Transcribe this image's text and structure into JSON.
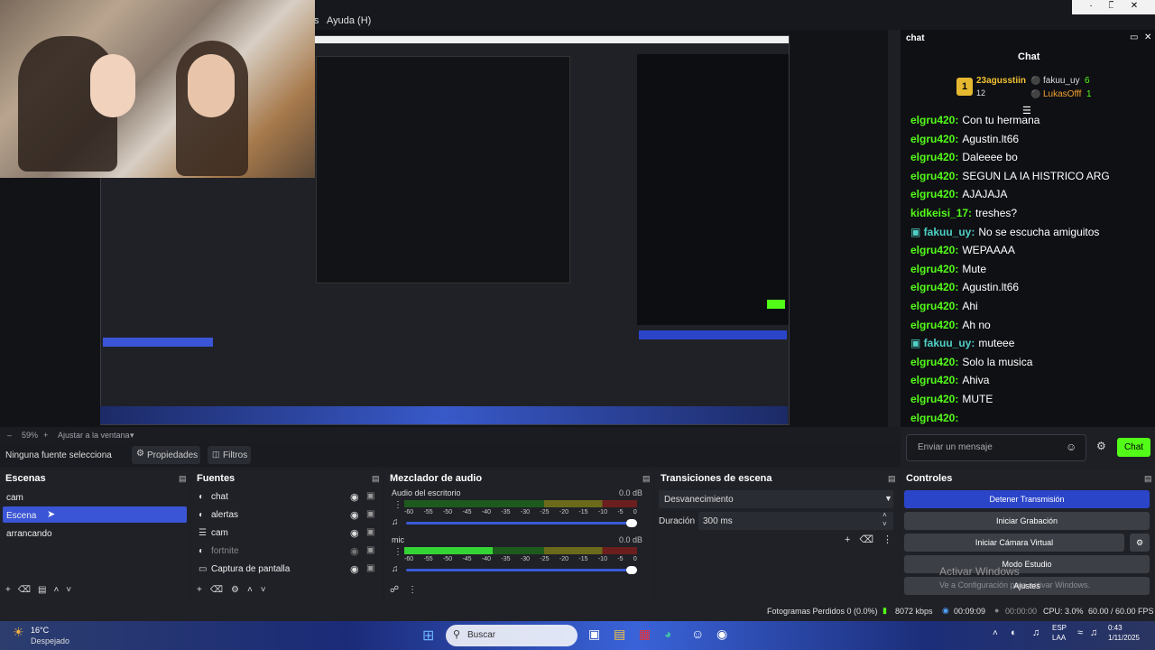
{
  "menu": {
    "help": "Ayuda (H)",
    "partial_left": "s"
  },
  "chat_dock": {
    "title": "chat",
    "header": "Chat",
    "leaderboard": [
      {
        "name": "23agusstiin",
        "count": "12"
      },
      {
        "name": "fakuu_uy",
        "count": "6"
      },
      {
        "name": "LukasOfff",
        "count": "1"
      }
    ],
    "messages": [
      {
        "user": "elgru420:",
        "text": "Con tu hermana",
        "color": "green"
      },
      {
        "user": "elgru420:",
        "text": "Agustin.lt66",
        "color": "green"
      },
      {
        "user": "elgru420:",
        "text": "Daleeee bo",
        "color": "green"
      },
      {
        "user": "elgru420:",
        "text": "SEGUN LA IA HISTRICO ARG",
        "color": "green"
      },
      {
        "user": "elgru420:",
        "text": "AJAJAJA",
        "color": "green"
      },
      {
        "user": "kidkeisi_17:",
        "text": "treshes?",
        "color": "green"
      },
      {
        "user": "fakuu_uy:",
        "text": "No se escucha amiguitos",
        "color": "teal"
      },
      {
        "user": "elgru420:",
        "text": "WEPAAAA",
        "color": "green"
      },
      {
        "user": "elgru420:",
        "text": "Mute",
        "color": "green"
      },
      {
        "user": "elgru420:",
        "text": "Agustin.lt66",
        "color": "green"
      },
      {
        "user": "elgru420:",
        "text": "Ahi",
        "color": "green"
      },
      {
        "user": "elgru420:",
        "text": "Ah no",
        "color": "green"
      },
      {
        "user": "fakuu_uy:",
        "text": "muteee",
        "color": "teal"
      },
      {
        "user": "elgru420:",
        "text": "Solo la musica",
        "color": "green"
      },
      {
        "user": "elgru420:",
        "text": "Ahiva",
        "color": "green"
      },
      {
        "user": "elgru420:",
        "text": "MUTE",
        "color": "green"
      },
      {
        "user": "elgru420:",
        "text": "",
        "color": "green"
      }
    ],
    "input_placeholder": "Enviar un mensaje",
    "send_label": "Chat"
  },
  "zoom": {
    "value": "59%",
    "fit_label": "Ajustar a la ventana"
  },
  "context": {
    "source_label": "Ninguna fuente selecciona",
    "properties": "Propiedades",
    "filters": "Filtros"
  },
  "scenes": {
    "title": "Escenas",
    "items": [
      "cam",
      "Escena",
      "arrancando"
    ],
    "selected_index": 1
  },
  "sources": {
    "title": "Fuentes",
    "items": [
      "chat",
      "alertas",
      "cam",
      "fortnite",
      "Captura de pantalla"
    ]
  },
  "mixer": {
    "title": "Mezclador de audio",
    "channels": [
      {
        "name": "Audio del escritorio",
        "db": "0.0 dB"
      },
      {
        "name": "mic",
        "db": "0.0 dB"
      }
    ],
    "scale": [
      "-60",
      "-55",
      "-50",
      "-45",
      "-40",
      "-35",
      "-30",
      "-25",
      "-20",
      "-15",
      "-10",
      "-5",
      "0"
    ]
  },
  "transitions": {
    "title": "Transiciones de escena",
    "selected": "Desvanecimiento",
    "duration_label": "Duración",
    "duration_value": "300 ms"
  },
  "controls": {
    "title": "Controles",
    "buttons": [
      "Detener Transmisión",
      "Iniciar Grabación",
      "Iniciar Cámara Virtual",
      "Modo Estudio",
      "Ajustes"
    ],
    "watermark_title": "Activar Windows",
    "watermark_sub": "Ve a Configuración para activar Windows."
  },
  "status": {
    "dropped": "Fotogramas Perdidos 0 (0.0%)",
    "bitrate": "8072 kbps",
    "stream_time": "00:09:09",
    "rec_time": "00:00:00",
    "cpu": "CPU: 3.0%",
    "fps": "60.00 / 60.00 FPS"
  },
  "taskbar": {
    "weather_temp": "16°C",
    "weather_desc": "Despejado",
    "search": "Buscar",
    "lang_1": "ESP",
    "lang_2": "LAA",
    "time": "0:43",
    "date": "1/11/2025"
  },
  "colors": {
    "accent": "#2b45c9",
    "kick_green": "#53fc18",
    "selected": "#3a55d6"
  }
}
